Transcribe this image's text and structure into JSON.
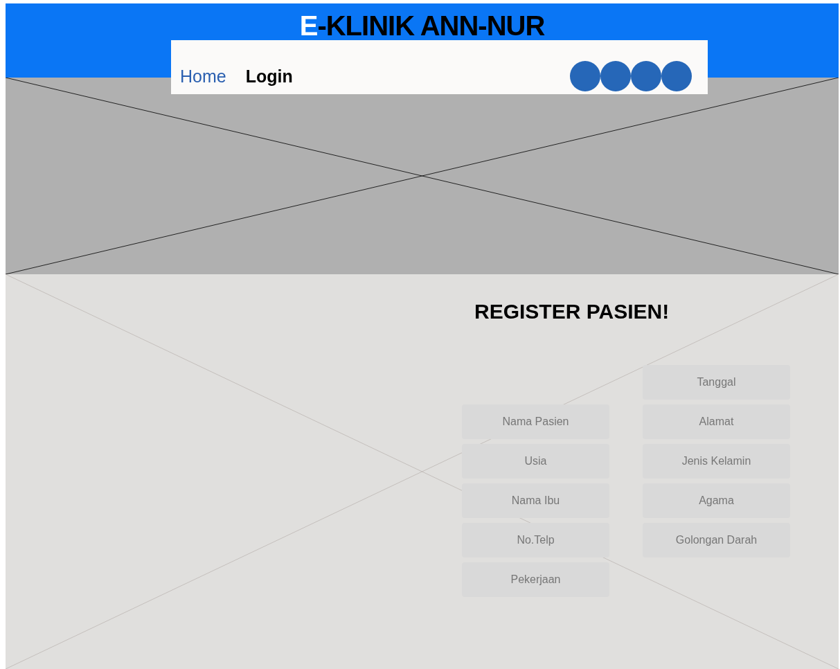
{
  "header": {
    "title": {
      "accent": "E",
      "rest": "-KLINIK ANN-NUR"
    }
  },
  "nav": {
    "items": [
      {
        "label": "Home",
        "selected": true
      },
      {
        "label": "Login",
        "selected": false
      }
    ]
  },
  "register": {
    "heading": "REGISTER PASIEN!",
    "left_fields": [
      {
        "placeholder": "Nama Pasien"
      },
      {
        "placeholder": "Usia"
      },
      {
        "placeholder": "Nama Ibu"
      },
      {
        "placeholder": "No.Telp"
      },
      {
        "placeholder": "Pekerjaan"
      }
    ],
    "right_fields": [
      {
        "placeholder": "Tanggal"
      },
      {
        "placeholder": "Alamat"
      },
      {
        "placeholder": "Jenis Kelamin"
      },
      {
        "placeholder": "Agama"
      },
      {
        "placeholder": "Golongan Darah"
      }
    ]
  }
}
